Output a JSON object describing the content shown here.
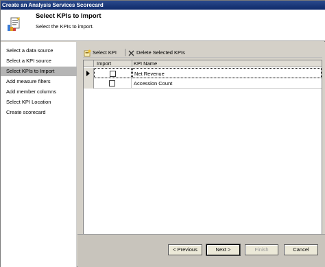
{
  "window": {
    "title": "Create an Analysis Services Scorecard"
  },
  "header": {
    "title": "Select KPIs to Import",
    "subtitle": "Select the KPIs to import.",
    "icon": "scorecard-wizard-icon"
  },
  "sidebar": {
    "items": [
      {
        "label": "Select a data source",
        "active": false
      },
      {
        "label": "Select a KPI source",
        "active": false
      },
      {
        "label": "Select KPIs to Import",
        "active": true
      },
      {
        "label": "Add measure filters",
        "active": false
      },
      {
        "label": "Add member columns",
        "active": false
      },
      {
        "label": "Select KPI Location",
        "active": false
      },
      {
        "label": "Create scorecard",
        "active": false
      }
    ]
  },
  "toolbar": {
    "select_kpi": "Select KPI",
    "delete_selected": "Delete Selected KPIs"
  },
  "grid": {
    "columns": [
      "Import",
      "KPI Name"
    ],
    "rows": [
      {
        "import": false,
        "name": "Net Revenue",
        "current": true
      },
      {
        "import": false,
        "name": "Accession Count",
        "current": false
      }
    ]
  },
  "buttons": {
    "previous": "< Previous",
    "next": "Next >",
    "finish": "Finish",
    "cancel": "Cancel"
  }
}
